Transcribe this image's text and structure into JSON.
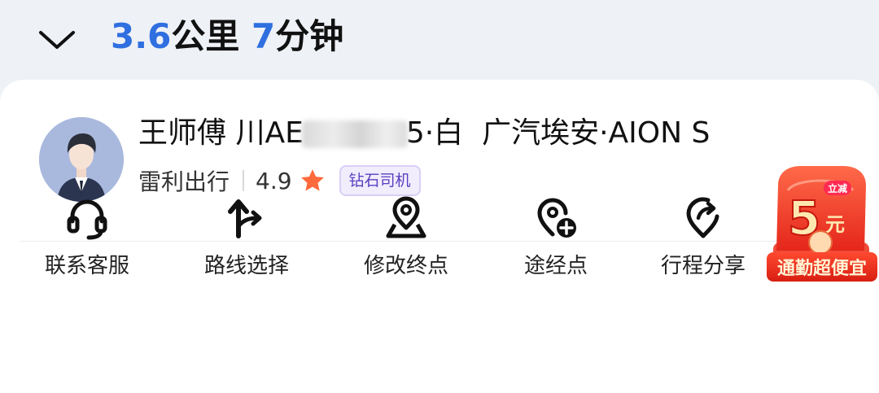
{
  "header": {
    "distance_value": "3.6",
    "distance_unit": "公里",
    "time_value": "7",
    "time_unit": "分钟"
  },
  "driver": {
    "name_and_plate_prefix": "王师傅 川AE",
    "plate_suffix_and_color": "5·白",
    "car_model": "广汽埃安·AION S",
    "company": "雷利出行",
    "rating": "4.9",
    "badge": "钻石司机"
  },
  "actions": [
    {
      "label": "联系客服",
      "icon": "headset-icon"
    },
    {
      "label": "路线选择",
      "icon": "route-arrow-icon"
    },
    {
      "label": "修改终点",
      "icon": "location-pin-icon"
    },
    {
      "label": "途经点",
      "icon": "add-location-icon"
    },
    {
      "label": "行程分享",
      "icon": "share-location-icon"
    }
  ],
  "promo": {
    "amount": "5",
    "unit": "元",
    "tag": "立减",
    "banner": "通勤超便宜"
  },
  "colors": {
    "accent_blue": "#2f6fe0",
    "star": "#ff6a3d",
    "badge_text": "#5a3fc0",
    "promo_red": "#f23a28"
  }
}
